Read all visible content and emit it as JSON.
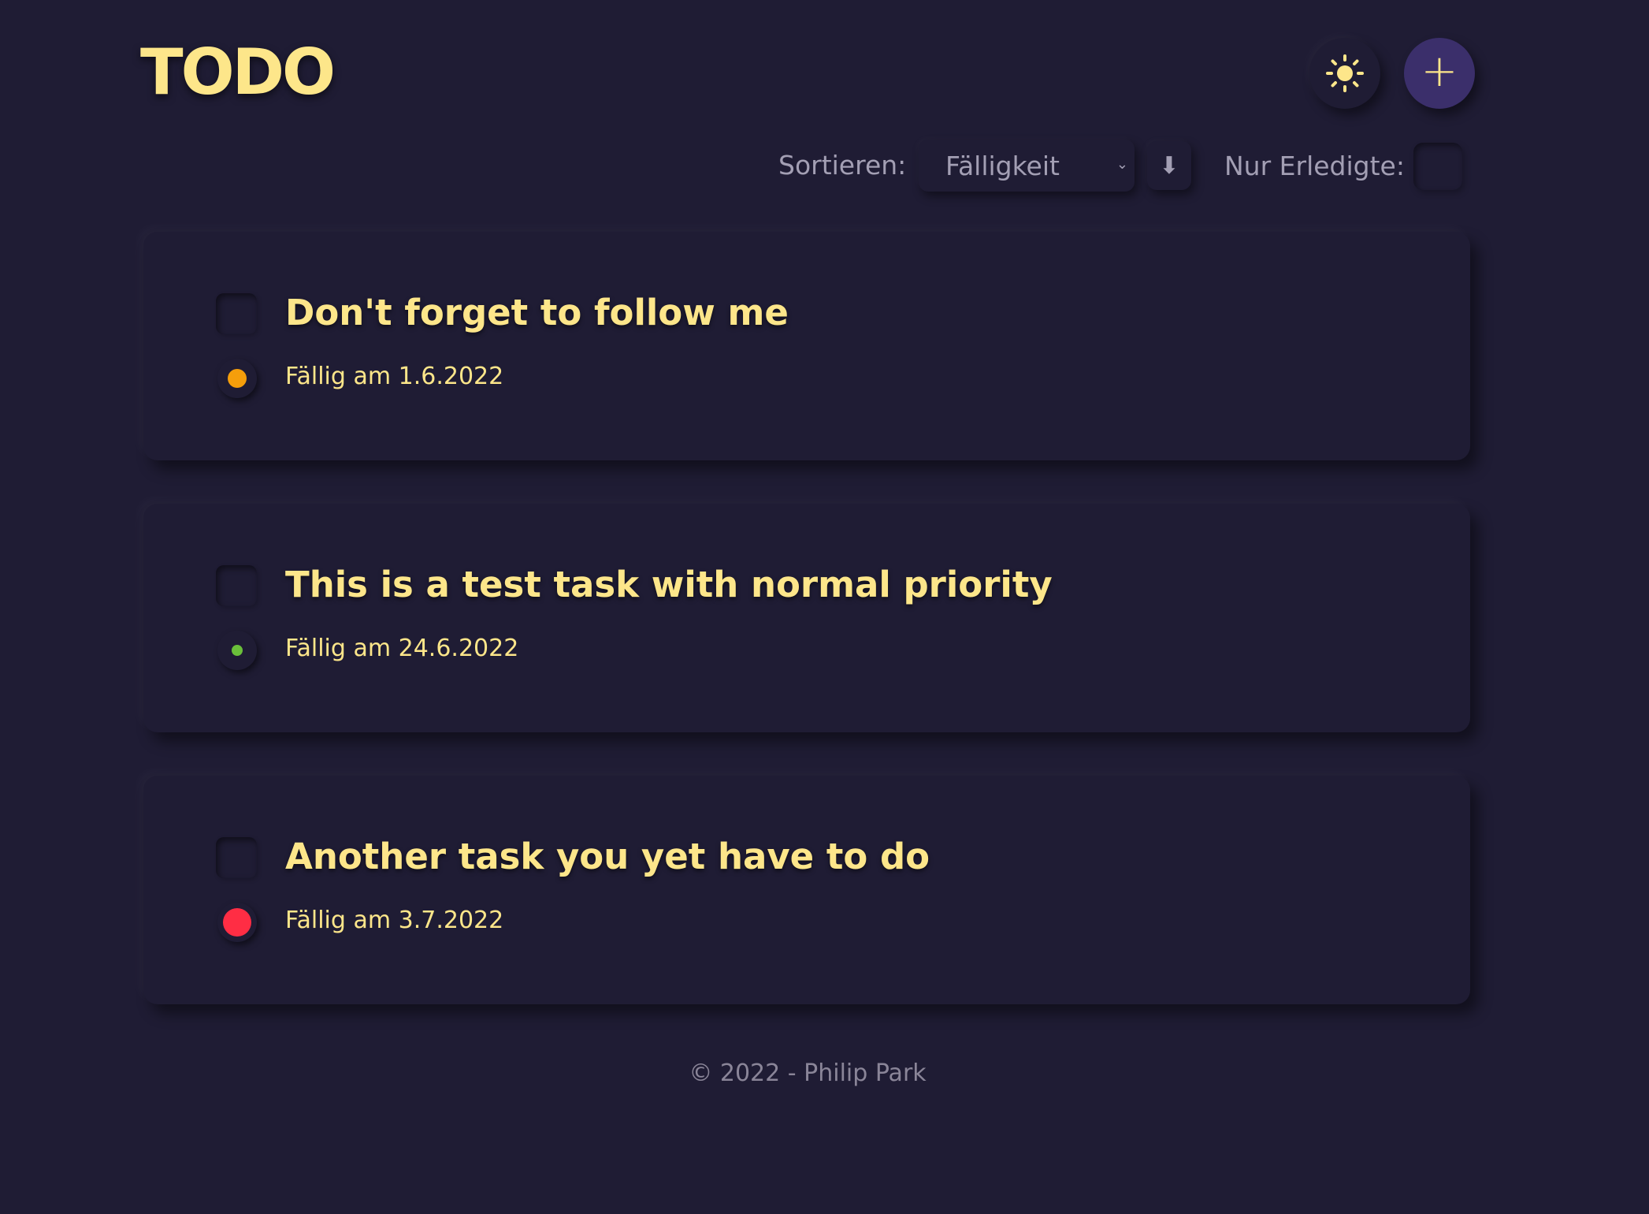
{
  "header": {
    "logo": "TODO",
    "theme_icon": "sun-icon",
    "add_icon": "plus-icon",
    "add_label": "+"
  },
  "toolbar": {
    "sort_label": "Sortieren:",
    "sort_selected": "Fälligkeit",
    "sort_direction_icon": "arrow-down-icon",
    "sort_direction": "⬇",
    "done_only_label": "Nur Erledigte:",
    "done_only_checked": false
  },
  "tasks": [
    {
      "title": "Don't forget to follow me",
      "due": "Fällig am 1.6.2022",
      "priority_color": "#f59e0b",
      "done": false
    },
    {
      "title": "This is a test task with normal priority",
      "due": "Fällig am 24.6.2022",
      "priority_color": "#6abf3a",
      "done": false
    },
    {
      "title": "Another task you yet have to do",
      "due": "Fällig am 3.7.2022",
      "priority_color": "#ff2d44",
      "done": false
    }
  ],
  "footer": {
    "text": "© 2022 - Philip Park"
  },
  "colors": {
    "background": "#1f1c34",
    "accent_text": "#fde68a",
    "muted_text": "#a39fb4",
    "add_button": "#3b2f6b"
  }
}
